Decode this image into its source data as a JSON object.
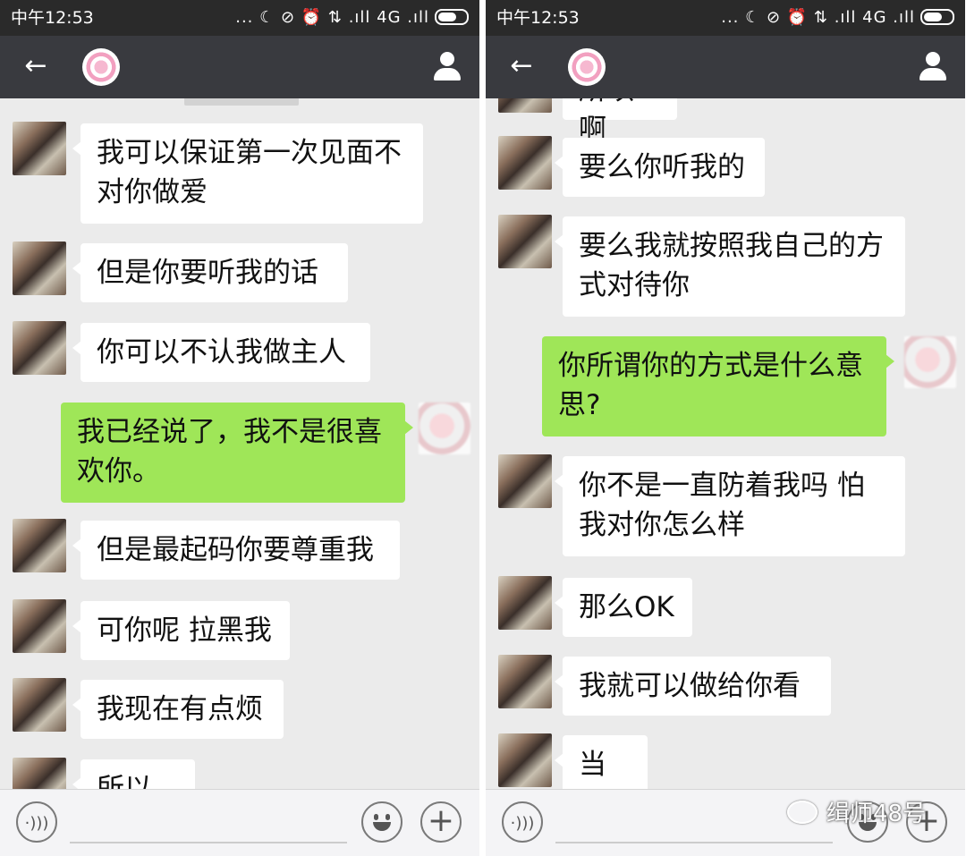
{
  "status": {
    "time": "中午12:53",
    "icons": "... ☾ ⊘ ⏰ ⇅ .ıll 4G .ıll"
  },
  "left": {
    "messages": [
      {
        "side": "recv",
        "text": "我可以保证第一次见面不对你做爱"
      },
      {
        "side": "recv",
        "text": "但是你要听我的话"
      },
      {
        "side": "recv",
        "text": "你可以不认我做主人"
      },
      {
        "side": "sent",
        "text": "我已经说了，我不是很喜欢你。"
      },
      {
        "side": "recv",
        "text": "但是最起码你要尊重我"
      },
      {
        "side": "recv",
        "text": "可你呢 拉黑我"
      },
      {
        "side": "recv",
        "text": "我现在有点烦"
      },
      {
        "side": "recv",
        "text": "所以啊"
      }
    ]
  },
  "right": {
    "messages": [
      {
        "side": "recv",
        "text": "所以啊"
      },
      {
        "side": "recv",
        "text": "要么你听我的"
      },
      {
        "side": "recv",
        "text": "要么我就按照我自己的方式对待你"
      },
      {
        "side": "sent",
        "text": "你所谓你的方式是什么意思?"
      },
      {
        "side": "recv",
        "text": "你不是一直防着我吗 怕我对你怎么样"
      },
      {
        "side": "recv",
        "text": "那么OK"
      },
      {
        "side": "recv",
        "text": "我就可以做给你看"
      },
      {
        "side": "recv",
        "text": "当然"
      }
    ]
  },
  "watermark": "缉师48号",
  "icons": {
    "back": "arrow-left-icon",
    "profile": "person-icon",
    "voice": "voice-icon",
    "emoji": "smiley-icon",
    "plus": "plus-icon"
  }
}
